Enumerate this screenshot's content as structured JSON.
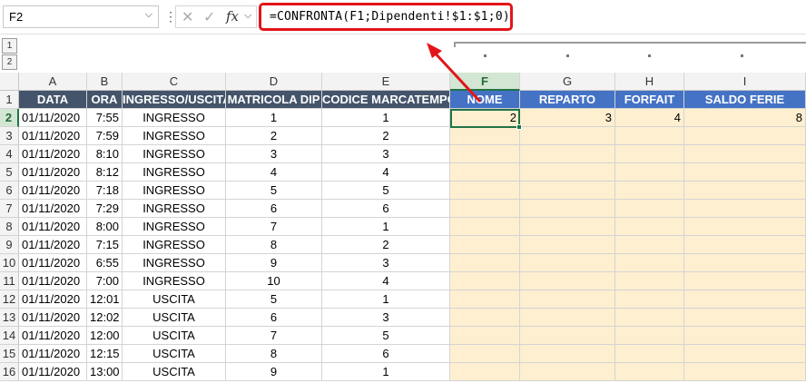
{
  "name_box": {
    "value": "F2"
  },
  "formula_bar": {
    "cancel_icon": "x-icon",
    "enter_icon": "check-icon",
    "fx_label": "fx",
    "formula": "=CONFRONTA(F1;Dipendenti!$1:$1;0)"
  },
  "outline": {
    "levels": [
      "1",
      "2"
    ]
  },
  "columns": [
    "A",
    "B",
    "C",
    "D",
    "E",
    "F",
    "G",
    "H",
    "I"
  ],
  "selected": {
    "column": "F",
    "row": "2"
  },
  "headers": [
    "DATA",
    "ORA",
    "INGRESSO/USCITA",
    "MATRICOLA DIP",
    "CODICE MARCATEMPO",
    "NOME",
    "REPARTO",
    "FORFAIT",
    "SALDO FERIE"
  ],
  "row2_lookup": [
    "2",
    "3",
    "4",
    "8"
  ],
  "rows": [
    {
      "n": "1"
    },
    {
      "n": "2",
      "data": "01/11/2020",
      "ora": "7:55",
      "io": "INGRESSO",
      "mat": "1",
      "cod": "1"
    },
    {
      "n": "3",
      "data": "01/11/2020",
      "ora": "7:59",
      "io": "INGRESSO",
      "mat": "2",
      "cod": "2"
    },
    {
      "n": "4",
      "data": "01/11/2020",
      "ora": "8:10",
      "io": "INGRESSO",
      "mat": "3",
      "cod": "3"
    },
    {
      "n": "5",
      "data": "01/11/2020",
      "ora": "8:12",
      "io": "INGRESSO",
      "mat": "4",
      "cod": "4"
    },
    {
      "n": "6",
      "data": "01/11/2020",
      "ora": "7:18",
      "io": "INGRESSO",
      "mat": "5",
      "cod": "5"
    },
    {
      "n": "7",
      "data": "01/11/2020",
      "ora": "7:29",
      "io": "INGRESSO",
      "mat": "6",
      "cod": "6"
    },
    {
      "n": "8",
      "data": "01/11/2020",
      "ora": "8:00",
      "io": "INGRESSO",
      "mat": "7",
      "cod": "1"
    },
    {
      "n": "9",
      "data": "01/11/2020",
      "ora": "7:15",
      "io": "INGRESSO",
      "mat": "8",
      "cod": "2"
    },
    {
      "n": "10",
      "data": "01/11/2020",
      "ora": "6:55",
      "io": "INGRESSO",
      "mat": "9",
      "cod": "3"
    },
    {
      "n": "11",
      "data": "01/11/2020",
      "ora": "7:00",
      "io": "INGRESSO",
      "mat": "10",
      "cod": "4"
    },
    {
      "n": "12",
      "data": "01/11/2020",
      "ora": "12:01",
      "io": "USCITA",
      "mat": "5",
      "cod": "1"
    },
    {
      "n": "13",
      "data": "01/11/2020",
      "ora": "12:02",
      "io": "USCITA",
      "mat": "6",
      "cod": "3"
    },
    {
      "n": "14",
      "data": "01/11/2020",
      "ora": "12:00",
      "io": "USCITA",
      "mat": "7",
      "cod": "5"
    },
    {
      "n": "15",
      "data": "01/11/2020",
      "ora": "12:15",
      "io": "USCITA",
      "mat": "8",
      "cod": "6"
    },
    {
      "n": "16",
      "data": "01/11/2020",
      "ora": "13:00",
      "io": "USCITA",
      "mat": "9",
      "cod": "1"
    }
  ],
  "colors": {
    "header_dark": "#44546a",
    "header_blue": "#4472c4",
    "lookup_fill": "#fdefcf",
    "selection": "#217346",
    "highlight": "#e3151a"
  }
}
